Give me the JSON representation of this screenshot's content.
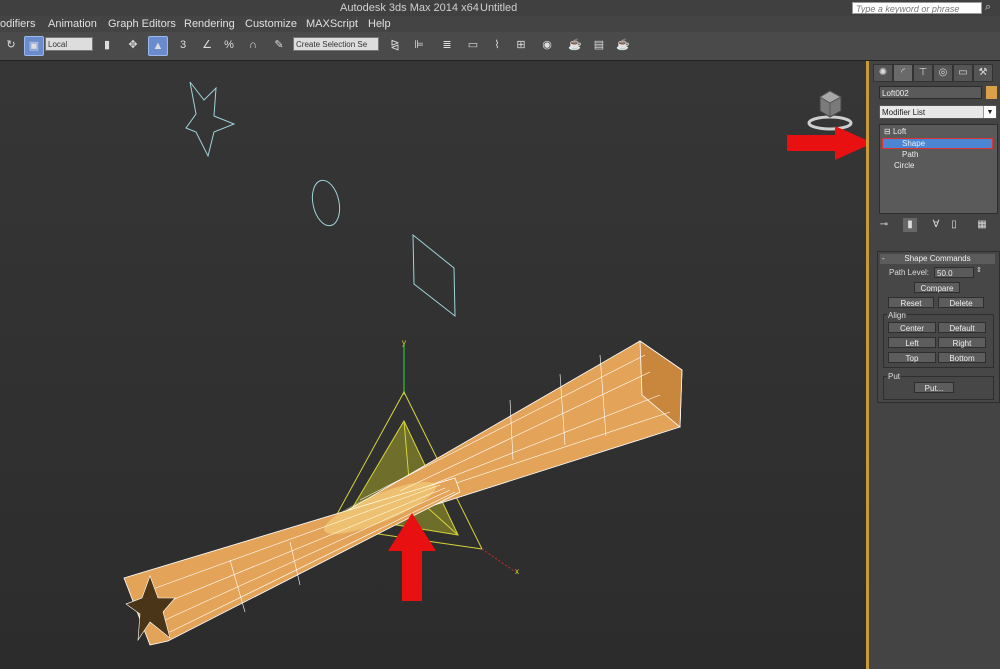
{
  "titlebar": {
    "title": "Autodesk 3ds Max  2014 x64",
    "doc": "Untitled",
    "search_placeholder": "Type a keyword or phrase"
  },
  "menu": [
    "odifiers",
    "Animation",
    "Graph Editors",
    "Rendering",
    "Customize",
    "MAXScript",
    "Help"
  ],
  "toolbar": {
    "coord_system": "Local",
    "selection_set": "Create Selection Se",
    "snap_label": "3"
  },
  "panel": {
    "object_name": "Loft002",
    "swatch_color": "#d9a14a",
    "modifier_list": "Modifier List",
    "stack": {
      "loft": "Loft",
      "shape": "Shape",
      "path": "Path",
      "circle": "Circle"
    },
    "rollout": {
      "title": "Shape Commands",
      "path_level_label": "Path Level:",
      "path_level_value": "50.0",
      "compare": "Compare",
      "reset": "Reset",
      "delete": "Delete",
      "align_label": "Align",
      "center": "Center",
      "default": "Default",
      "left": "Left",
      "right": "Right",
      "top": "Top",
      "bottom": "Bottom",
      "put_label": "Put",
      "put_button": "Put..."
    }
  },
  "viewport": {
    "axis_x": "x",
    "axis_y": "y"
  },
  "colors": {
    "accent": "#c79a3a",
    "selection": "#4a86d4",
    "annotation": "#e81010",
    "loft": "#e3a45a"
  }
}
